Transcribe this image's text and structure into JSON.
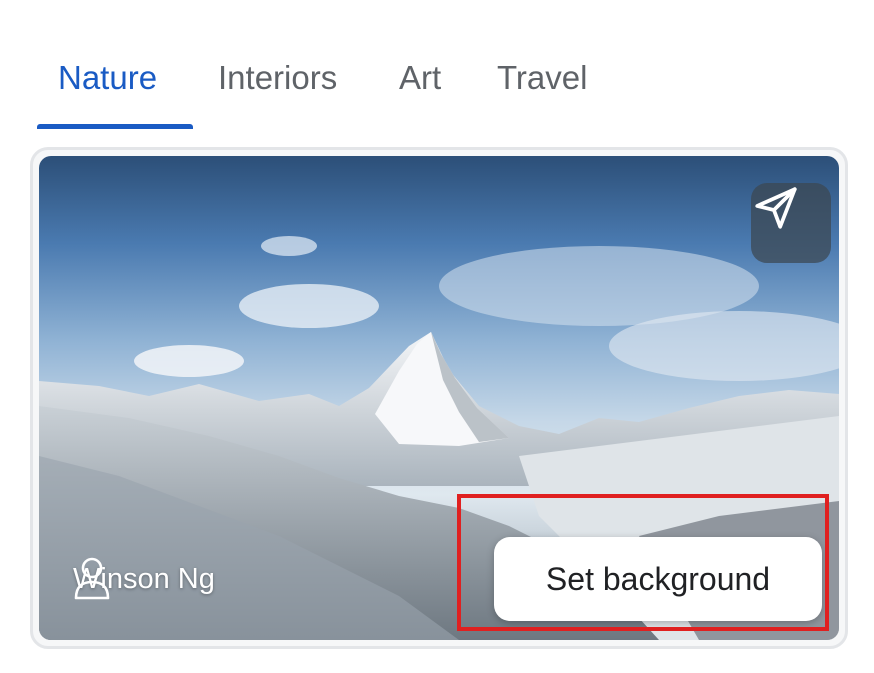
{
  "tabs": [
    {
      "label": "Nature",
      "active": true
    },
    {
      "label": "Interiors",
      "active": false
    },
    {
      "label": "Art",
      "active": false
    },
    {
      "label": "Travel",
      "active": false
    }
  ],
  "card": {
    "author": {
      "name": "Winson Ng",
      "icon": "person-icon"
    },
    "share_icon": "send-icon",
    "action_label": "Set background"
  },
  "colors": {
    "accent": "#1a5bc4",
    "tab_inactive": "#5f6368",
    "highlight": "#e02020"
  }
}
